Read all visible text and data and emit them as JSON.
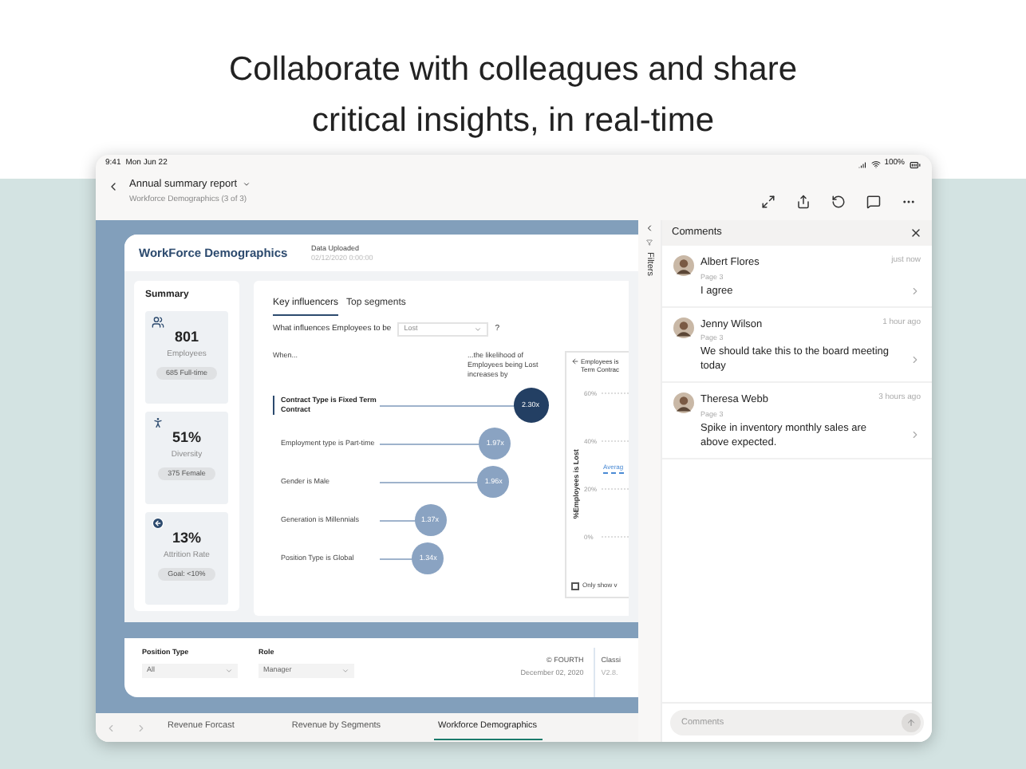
{
  "headline": "Collaborate with colleagues and share critical insights, in real-time",
  "status_bar": {
    "time": "9:41",
    "date": "Mon Jun 22",
    "battery": "100%"
  },
  "header": {
    "title": "Annual summary report",
    "subtitle": "Workforce Demographics (3 of 3)"
  },
  "report": {
    "title": "WorkForce Demographics",
    "upload_label": "Data Uploaded",
    "upload_date": "02/12/2020 0:00:00",
    "summary": {
      "title": "Summary",
      "cards": [
        {
          "kind": "people",
          "value": "801",
          "label": "Employees",
          "pill": "685 Full-time"
        },
        {
          "kind": "person",
          "value": "51%",
          "label": "Diversity",
          "pill": "375 Female"
        },
        {
          "kind": "exit",
          "value": "13%",
          "label": "Attrition Rate",
          "pill": "Goal: <10%"
        }
      ]
    },
    "tabs": [
      {
        "label": "Key influencers",
        "selected": true
      },
      {
        "label": "Top segments",
        "selected": false
      }
    ],
    "question": "What influences Employees to be",
    "dropdown": "Lost",
    "help": "?",
    "when": "When...",
    "likelihood": "...the likelihood of Employees being Lost increases by",
    "influencers": [
      {
        "label": "Contract Type is Fixed Term Contract",
        "value": "2.30x",
        "level": 0.9,
        "selected": true
      },
      {
        "label": "Employment type is Part-time",
        "value": "1.97x",
        "level": 0.69,
        "selected": false
      },
      {
        "label": "Gender is Male",
        "value": "1.96x",
        "level": 0.68,
        "selected": false
      },
      {
        "label": "Generation is Millennials",
        "value": "1.37x",
        "level": 0.3,
        "selected": false
      },
      {
        "label": "Position Type is Global",
        "value": "1.34x",
        "level": 0.29,
        "selected": false
      }
    ],
    "side_chart": {
      "title_lines": [
        "Employees is",
        "Term Contrac"
      ],
      "ylabel": "%Employees is Lost",
      "ticks": [
        "60%",
        "40%",
        "20%",
        "0%"
      ],
      "average": "Averag",
      "checkbox": {
        "label": "Only show v",
        "checked": false
      }
    },
    "filters": [
      {
        "label": "Position Type",
        "value": "All"
      },
      {
        "label": "Role",
        "value": "Manager"
      }
    ],
    "copyright": "© FOURTH",
    "date": "December 02, 2020",
    "cut_label": "Classi",
    "cut_value": "V2.8."
  },
  "page_tabs": [
    {
      "label": "Revenue Forcast",
      "selected": false
    },
    {
      "label": "Revenue by Segments",
      "selected": false
    },
    {
      "label": "Workforce Demographics",
      "selected": true
    }
  ],
  "filters_label": "Filters",
  "comments": {
    "title": "Comments",
    "items": [
      {
        "name": "Albert Flores",
        "page": "Page 3",
        "time": "just now",
        "text": "I agree"
      },
      {
        "name": "Jenny Wilson",
        "page": "Page 3",
        "time": "1 hour ago",
        "text": "We should take this to the board meeting today"
      },
      {
        "name": "Theresa Webb",
        "page": "Page 3",
        "time": "3 hours ago",
        "text": "Spike in inventory monthly sales are above expected."
      }
    ],
    "input": {
      "placeholder": "Comments"
    }
  }
}
